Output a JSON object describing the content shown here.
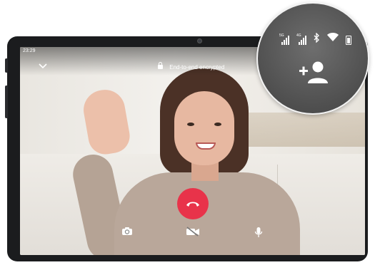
{
  "status_bar": {
    "time": "23:29"
  },
  "call": {
    "encryption_label": "End-to-end encrypted",
    "minimize_icon": "chevron-down-icon",
    "end_call_icon": "phone-hangup-icon",
    "camera_switch_icon": "camera-switch-icon",
    "video_off_icon": "video-off-icon",
    "mic_icon": "microphone-icon",
    "add_participant_icon": "add-person-icon"
  },
  "magnified_status": {
    "signal_1_label": "5G",
    "signal_2_label": "4G",
    "bluetooth_icon": "bluetooth-icon",
    "wifi_icon": "wifi-icon",
    "battery_icon": "battery-icon"
  },
  "colors": {
    "end_call": "#e8334a",
    "frame": "#1b1c1e"
  }
}
